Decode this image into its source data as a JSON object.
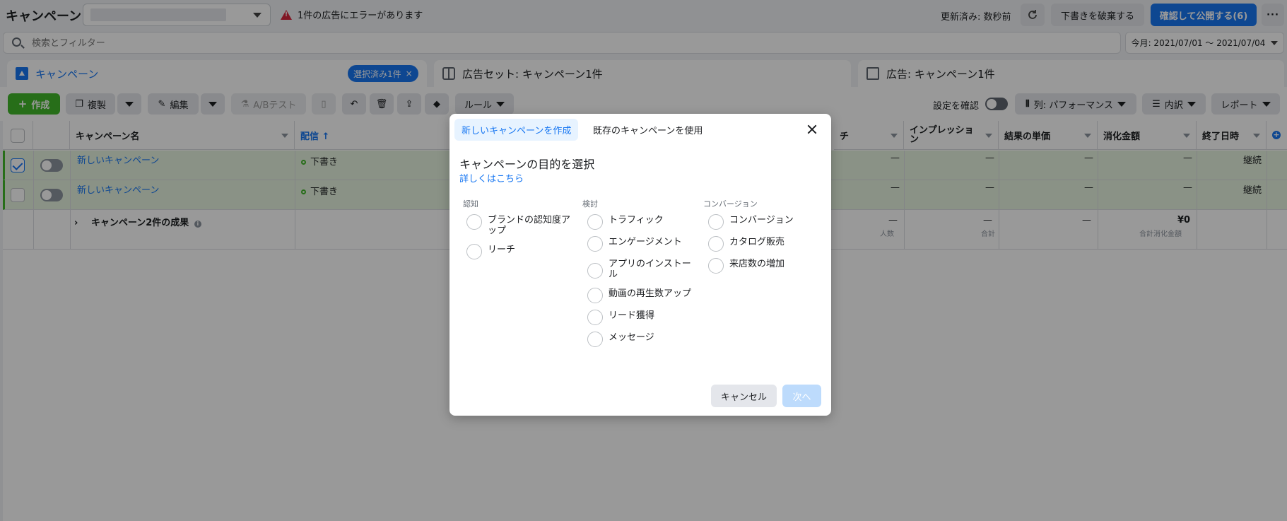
{
  "header": {
    "title": "キャンペーン",
    "error_text": "1件の広告にエラーがあります",
    "updated": "更新済み: 数秒前",
    "discard_label": "下書きを破棄する",
    "publish_label": "確認して公開する(6)"
  },
  "search": {
    "placeholder": "検索とフィルター",
    "date_range": "今月: 2021/07/01 ～ 2021/07/04"
  },
  "level_tabs": {
    "campaign": "キャンペーン",
    "selected_chip": "選択済み1件",
    "adset": "広告セット: キャンペーン1件",
    "ad": "広告: キャンペーン1件"
  },
  "toolbar": {
    "create": "作成",
    "duplicate": "複製",
    "edit": "編集",
    "ab_test": "A/Bテスト",
    "rules": "ルール",
    "review_settings": "設定を確認",
    "columns": "列: パフォーマンス",
    "breakdown": "内訳",
    "reports": "レポート"
  },
  "table": {
    "headers": {
      "name": "キャンペーン名",
      "delivery": "配信 ↑",
      "reach": "チ",
      "impressions": "インプレッション",
      "cost_per_result": "結果の単価",
      "spend": "消化金額",
      "end_date": "終了日時"
    },
    "rows": [
      {
        "name": "新しいキャンペーン",
        "delivery": "下書き",
        "reach": "—",
        "impressions": "—",
        "cpr": "—",
        "spend": "—",
        "end": "継続"
      },
      {
        "name": "新しいキャンペーン",
        "delivery": "下書き",
        "reach": "—",
        "impressions": "—",
        "cpr": "—",
        "spend": "—",
        "end": "継続"
      }
    ],
    "summary": {
      "label": "キャンペーン2件の成果",
      "reach": "—",
      "reach_sub": "人数",
      "impressions": "—",
      "impressions_sub": "合計",
      "cpr": "—",
      "spend": "¥0",
      "spend_sub": "合計消化金額"
    }
  },
  "modal": {
    "tab_new": "新しいキャンペーンを作成",
    "tab_existing": "既存のキャンペーンを使用",
    "title": "キャンペーンの目的を選択",
    "learn_more": "詳しくはこちら",
    "columns": [
      {
        "heading": "認知",
        "options": [
          "ブランドの認知度アップ",
          "リーチ"
        ]
      },
      {
        "heading": "検討",
        "options": [
          "トラフィック",
          "エンゲージメント",
          "アプリのインストール",
          "動画の再生数アップ",
          "リード獲得",
          "メッセージ"
        ]
      },
      {
        "heading": "コンバージョン",
        "options": [
          "コンバージョン",
          "カタログ販売",
          "来店数の増加"
        ]
      }
    ],
    "cancel": "キャンセル",
    "next": "次へ"
  },
  "colors": {
    "accent": "#1877f2",
    "create_green": "#42b72a",
    "error_red": "#d7263d"
  }
}
